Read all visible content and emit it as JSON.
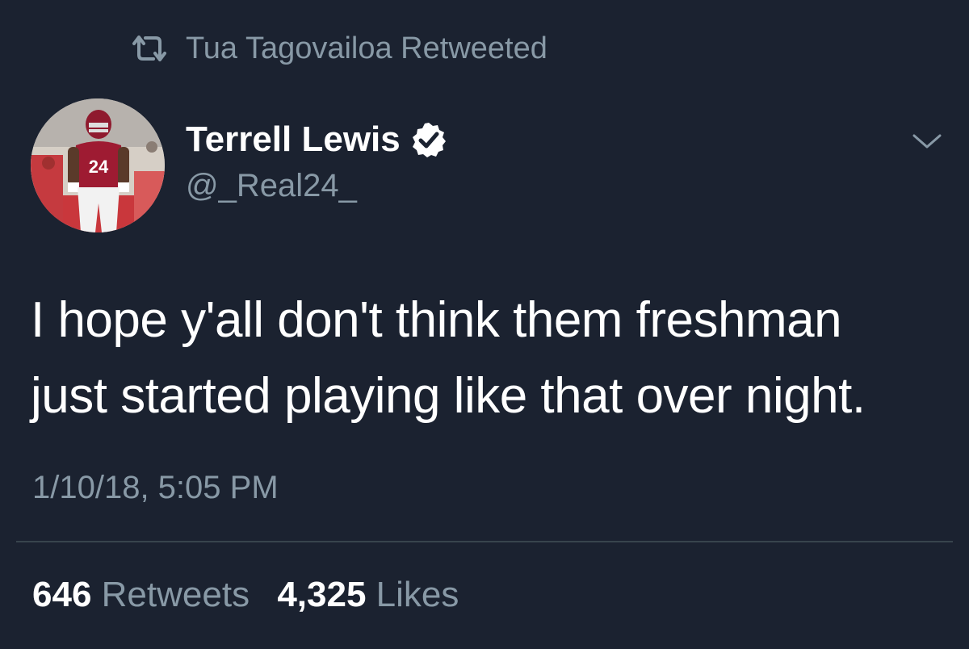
{
  "retweet_header": {
    "icon": "retweet-icon",
    "text": "Tua Tagovailoa Retweeted"
  },
  "author": {
    "name": "Terrell Lewis",
    "handle": "@_Real24_",
    "verified": true,
    "avatar_jersey_number": "24"
  },
  "tweet": {
    "lines": [
      "I hope y'all don't think them freshman",
      "just started playing like that over night."
    ],
    "timestamp": "1/10/18, 5:05 PM"
  },
  "stats": {
    "retweets_count": "646",
    "retweets_label": "Retweets",
    "likes_count": "4,325",
    "likes_label": "Likes"
  },
  "colors": {
    "background": "#1b2230",
    "secondary_text": "#8899a6",
    "primary_text": "#ffffff",
    "divider": "#38444d",
    "jersey": "#9e1b32"
  }
}
